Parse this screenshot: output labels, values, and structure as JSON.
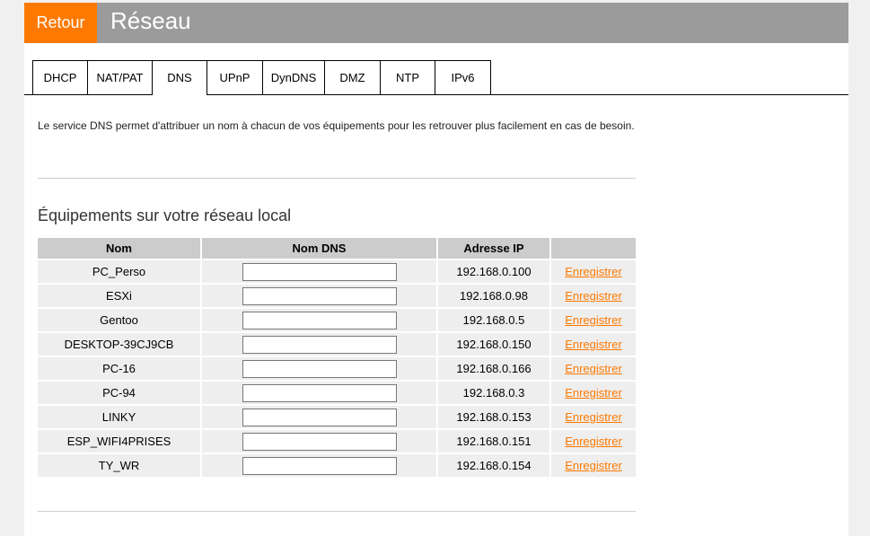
{
  "header": {
    "back_label": "Retour",
    "title": "Réseau"
  },
  "tabs": [
    {
      "label": "DHCP",
      "active": false
    },
    {
      "label": "NAT/PAT",
      "active": false
    },
    {
      "label": "DNS",
      "active": true
    },
    {
      "label": "UPnP",
      "active": false
    },
    {
      "label": "DynDNS",
      "active": false
    },
    {
      "label": "DMZ",
      "active": false
    },
    {
      "label": "NTP",
      "active": false
    },
    {
      "label": "IPv6",
      "active": false
    }
  ],
  "intro": "Le service DNS permet d'attribuer un nom à chacun de vos équipements pour les retrouver plus facilement en cas de besoin.",
  "section_title": "Équipements sur votre réseau local",
  "table": {
    "headers": [
      "Nom",
      "Nom DNS",
      "Adresse IP",
      ""
    ],
    "save_label": "Enregistrer",
    "rows": [
      {
        "name": "PC_Perso",
        "dns": "",
        "ip": "192.168.0.100"
      },
      {
        "name": "ESXi",
        "dns": "",
        "ip": "192.168.0.98"
      },
      {
        "name": "Gentoo",
        "dns": "",
        "ip": "192.168.0.5"
      },
      {
        "name": "DESKTOP-39CJ9CB",
        "dns": "",
        "ip": "192.168.0.150"
      },
      {
        "name": "PC-16",
        "dns": "",
        "ip": "192.168.0.166"
      },
      {
        "name": "PC-94",
        "dns": "",
        "ip": "192.168.0.3"
      },
      {
        "name": "LINKY",
        "dns": "",
        "ip": "192.168.0.153"
      },
      {
        "name": "ESP_WIFI4PRISES",
        "dns": "",
        "ip": "192.168.0.151"
      },
      {
        "name": "TY_WR",
        "dns": "",
        "ip": "192.168.0.154"
      }
    ]
  },
  "colors": {
    "accent": "#ff7900",
    "header_bg": "#9b9b9b",
    "table_header_bg": "#cccccc",
    "row_bg": "#eeeeee"
  }
}
